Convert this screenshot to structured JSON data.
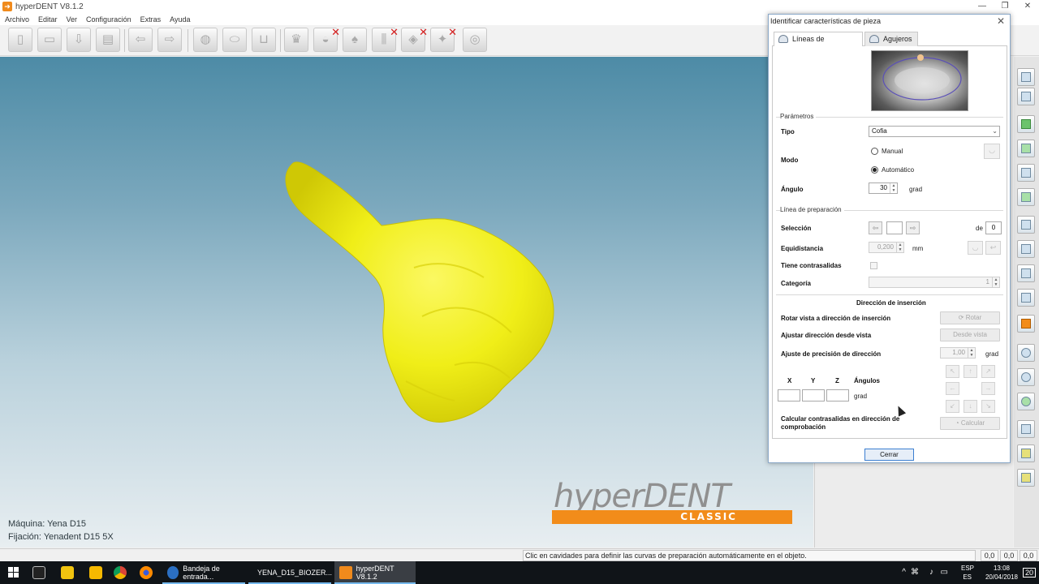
{
  "window": {
    "title": "hyperDENT V8.1.2"
  },
  "menu": [
    "Archivo",
    "Editar",
    "Ver",
    "Configuración",
    "Extras",
    "Ayuda"
  ],
  "toolbar": {
    "buttons": [
      {
        "icon": "new-document-icon"
      },
      {
        "icon": "open-folder-icon"
      },
      {
        "icon": "import-icon"
      },
      {
        "icon": "print-icon"
      },
      {
        "icon": "undo-arrow-icon"
      },
      {
        "icon": "redo-arrow-icon"
      },
      {
        "icon": "stock-icon"
      },
      {
        "icon": "blank-icon"
      },
      {
        "icon": "fixture-icon"
      },
      {
        "icon": "tooth-icon"
      },
      {
        "icon": "tooth-remove-icon"
      },
      {
        "icon": "tooth-shape-icon"
      },
      {
        "icon": "tool-remove-icon"
      },
      {
        "icon": "path-remove-icon"
      },
      {
        "icon": "simulate-remove-icon"
      },
      {
        "icon": "export-icon"
      }
    ]
  },
  "viewport": {
    "machine_label": "Máquina: Yena D15",
    "fixture_label": "Fijación: Yenadent D15 5X",
    "logo_word": "hyperDENT",
    "logo_sub": "CLASSIC",
    "logo_color": "#f28c1a",
    "object_color": "#f0ee18"
  },
  "dialog": {
    "title": "Identificar características de pieza",
    "tabs": [
      {
        "label": "Líneas de preparación",
        "active": true,
        "icon": "prep-line-icon"
      },
      {
        "label": "Agujeros",
        "active": false,
        "icon": "holes-icon"
      }
    ],
    "parameters": {
      "group_label": "Parámetros",
      "tipo_label": "Tipo",
      "tipo_value": "Cofia",
      "modo_label": "Modo",
      "modo_manual": "Manual",
      "modo_auto": "Automático",
      "angulo_label": "Ángulo",
      "angulo_value": "30",
      "angulo_unit": "grad"
    },
    "prep_line": {
      "group_label": "Línea de preparación",
      "seleccion_label": "Selección",
      "seleccion_de": "de",
      "seleccion_total": "0",
      "equidistancia_label": "Equidistancia",
      "equidistancia_value": "0,200",
      "equidistancia_unit": "mm",
      "contrasalidas_label": "Tiene contrasalidas",
      "categoria_label": "Categoría",
      "categoria_value": "1"
    },
    "insertion": {
      "heading": "Dirección de inserción",
      "rotar_label": "Rotar vista a dirección de inserción",
      "rotar_button": "Rotar",
      "ajustar_label": "Ajustar dirección desde vista",
      "ajustar_button": "Desde vista",
      "precision_label": "Ajuste de precisión de dirección",
      "precision_value": "1,00",
      "precision_unit": "grad",
      "x_label": "X",
      "y_label": "Y",
      "z_label": "Z",
      "angulos_label": "Ángulos",
      "xyz_unit": "grad",
      "calcular_label": "Calcular contrasalidas en dirección de comprobación",
      "calcular_button": "Calcular"
    },
    "close_button": "Cerrar"
  },
  "statusbar": {
    "message": "Clic en cavidades para definir las curvas de preparación automáticamente en el objeto.",
    "coords": [
      "0,0",
      "0,0",
      "0,0"
    ]
  },
  "taskbar": {
    "items": [
      {
        "label": "Bandeja de entrada...",
        "icon": "outlook-icon",
        "active": false
      },
      {
        "label": "YENA_D15_BIOZER...",
        "icon": "hyperdent-icon",
        "active": false
      },
      {
        "label": "hyperDENT V8.1.2",
        "icon": "hyperdent-icon",
        "active": true
      }
    ],
    "lang_top": "ESP",
    "lang_bottom": "ES",
    "time": "13:08",
    "date": "20/04/2018",
    "notifications": "20"
  }
}
